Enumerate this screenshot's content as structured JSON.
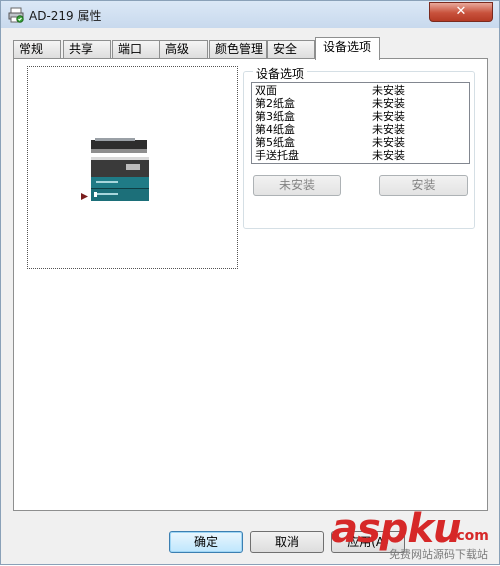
{
  "window": {
    "title": "AD-219 属性"
  },
  "tabs": [
    {
      "label": "常规"
    },
    {
      "label": "共享"
    },
    {
      "label": "端口"
    },
    {
      "label": "高级"
    },
    {
      "label": "颜色管理"
    },
    {
      "label": "安全"
    },
    {
      "label": "设备选项",
      "active": true
    }
  ],
  "device_options": {
    "group_title": "设备选项",
    "items": [
      {
        "name": "双面",
        "status": "未安装"
      },
      {
        "name": "第2纸盒",
        "status": "未安装"
      },
      {
        "name": "第3纸盒",
        "status": "未安装"
      },
      {
        "name": "第4纸盒",
        "status": "未安装"
      },
      {
        "name": "第5纸盒",
        "status": "未安装"
      },
      {
        "name": "手送托盘",
        "status": "未安装"
      }
    ],
    "not_installed_button": "未安装",
    "install_button": "安装"
  },
  "footer": {
    "ok_label": "确定",
    "cancel_label": "取消",
    "apply_label": "应用(A)"
  },
  "watermark": {
    "logo": "aspku",
    "tld": ".com",
    "sub": "免费网站源码下载站"
  },
  "colors": {
    "accent": "#3c7fb1",
    "close": "#c8523c",
    "watermark": "#d62828",
    "device_teal": "#1f7b86"
  }
}
